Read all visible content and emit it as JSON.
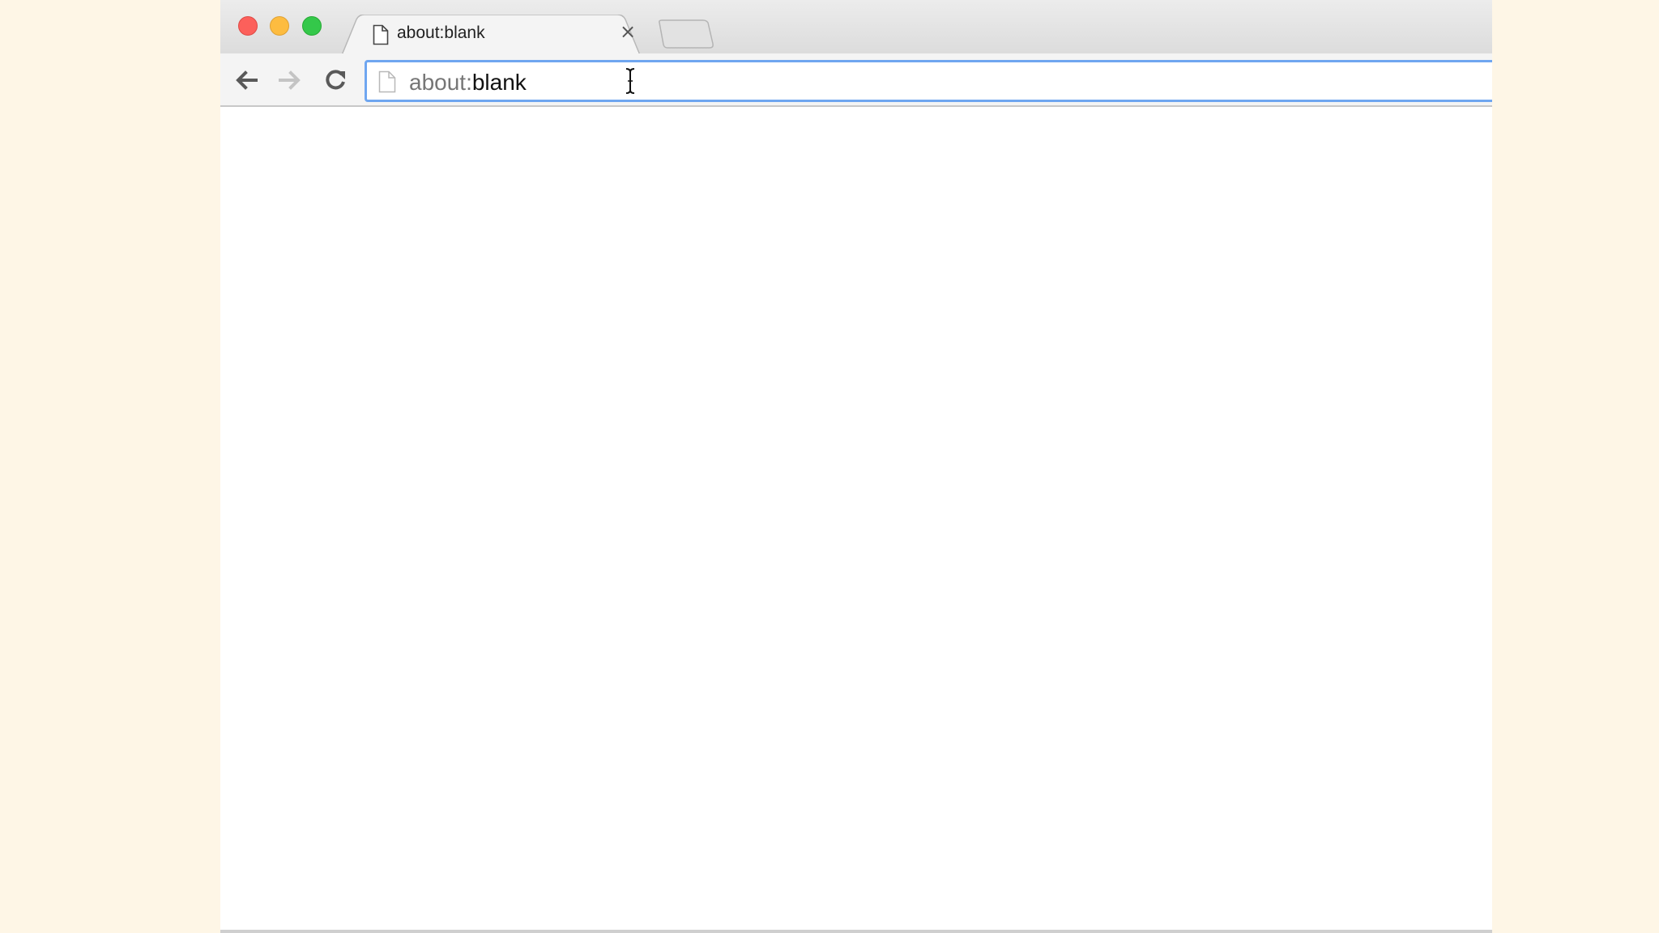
{
  "tab": {
    "title": "about:blank",
    "favicon": "page-icon",
    "close_glyph": "×"
  },
  "toolbar": {
    "back_icon": "back-arrow-icon",
    "forward_icon": "forward-arrow-icon",
    "reload_icon": "reload-icon",
    "forward_enabled": false
  },
  "omnibox": {
    "scheme": "about:",
    "host": "blank",
    "focused": true
  },
  "colors": {
    "focus_ring": "#6fa6f0",
    "close_light": "#fc605b",
    "minimize_light": "#fdbc40",
    "zoom_light": "#34c84a",
    "desktop_background": "#fef6e6"
  }
}
